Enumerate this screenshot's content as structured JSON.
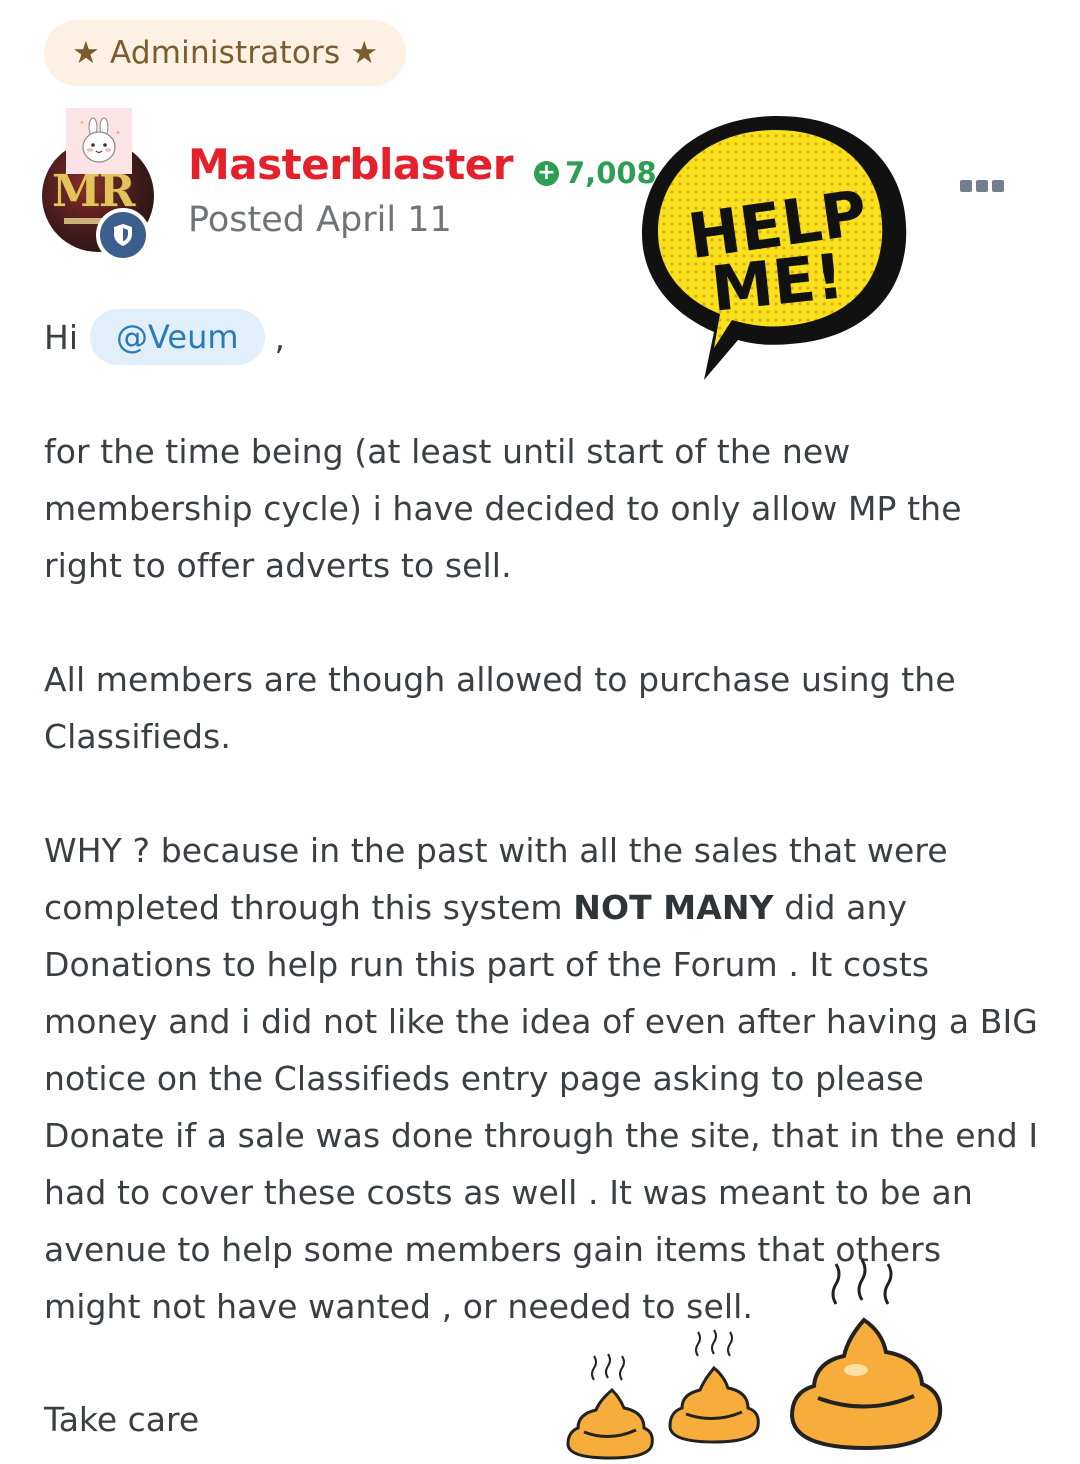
{
  "group_badge": "★ Administrators ★",
  "author": {
    "name": "Masterblaster",
    "posted": "Posted April 11",
    "reputation": "7,008",
    "avatar_initials": "MR"
  },
  "sticker_help": {
    "line1": "HELP",
    "line2": "ME!"
  },
  "post": {
    "greeting": "Hi",
    "mention": "@Veum",
    "greeting_tail": ",",
    "paragraph1": "for the time being (at least until start of the new membership cycle) i have decided to only allow MP the right to offer adverts to sell.",
    "paragraph2": "All members are though allowed to purchase using the Classifieds.",
    "paragraph3_before": "WHY ?  because in the past with all the sales that were completed through this system ",
    "paragraph3_bold": "NOT MANY",
    "paragraph3_after": " did any Donations to help run this part of the Forum  .  It costs money and i did not like the idea of even after having a BIG notice on the Classifieds entry page asking to please Donate if a sale was done through the site, that in the end I had to cover these costs as well .  It was meant to be an avenue to help some members gain items that others might not have wanted , or needed to sell.",
    "signoff": "Take care"
  },
  "colors": {
    "username": "#e4202b",
    "reputation": "#2e9e55",
    "mention_bg": "#e1effa",
    "mention_text": "#2b7ab8",
    "badge_bg": "#fcf1e3",
    "badge_text": "#7a5c2e"
  },
  "icons": [
    "reputation-plus-icon",
    "moderator-shield-icon",
    "post-menu-icon",
    "poop-emoji-icon",
    "bunny-sticker-icon"
  ]
}
